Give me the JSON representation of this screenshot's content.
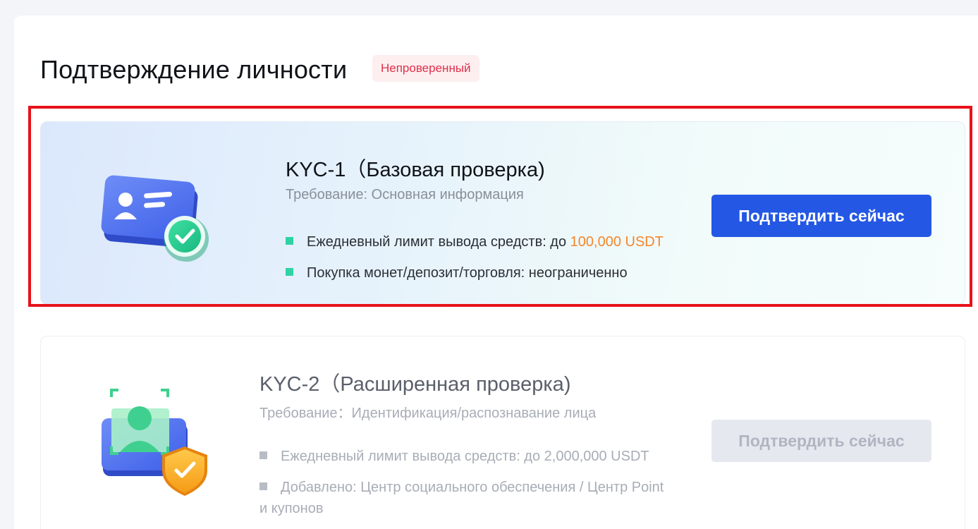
{
  "page": {
    "title": "Подтверждение личности",
    "status_badge": "Непроверенный"
  },
  "kyc1": {
    "title": "KYC-1（Базовая проверка)",
    "requirement": "Требование: Основная информация",
    "bullets": [
      {
        "text": "Ежедневный лимит вывода средств: до ",
        "accent": "100,000 USDT"
      },
      {
        "text": "Покупка монет/депозит/торговля: неограниченно"
      }
    ],
    "button_label": "Подтвердить сейчас",
    "icon": "id-card-check-icon"
  },
  "kyc2": {
    "title": "KYC-2（Расширенная проверка)",
    "requirement": "Требование：Идентификация/распознавание лица",
    "bullets": [
      {
        "text": "Ежедневный лимит вывода средств: до 2,000,000 USDT"
      },
      {
        "text": "Добавлено: Центр социального обеспечения / Центр Point",
        "text2": "и купонов"
      }
    ],
    "button_label": "Подтвердить сейчас",
    "icon": "face-scan-shield-icon"
  },
  "colors": {
    "primary": "#2457e4",
    "accent": "#f5862b",
    "bullet_active": "#2fd3a3",
    "badge_text": "#e0304a",
    "highlight": "#e8121a"
  }
}
